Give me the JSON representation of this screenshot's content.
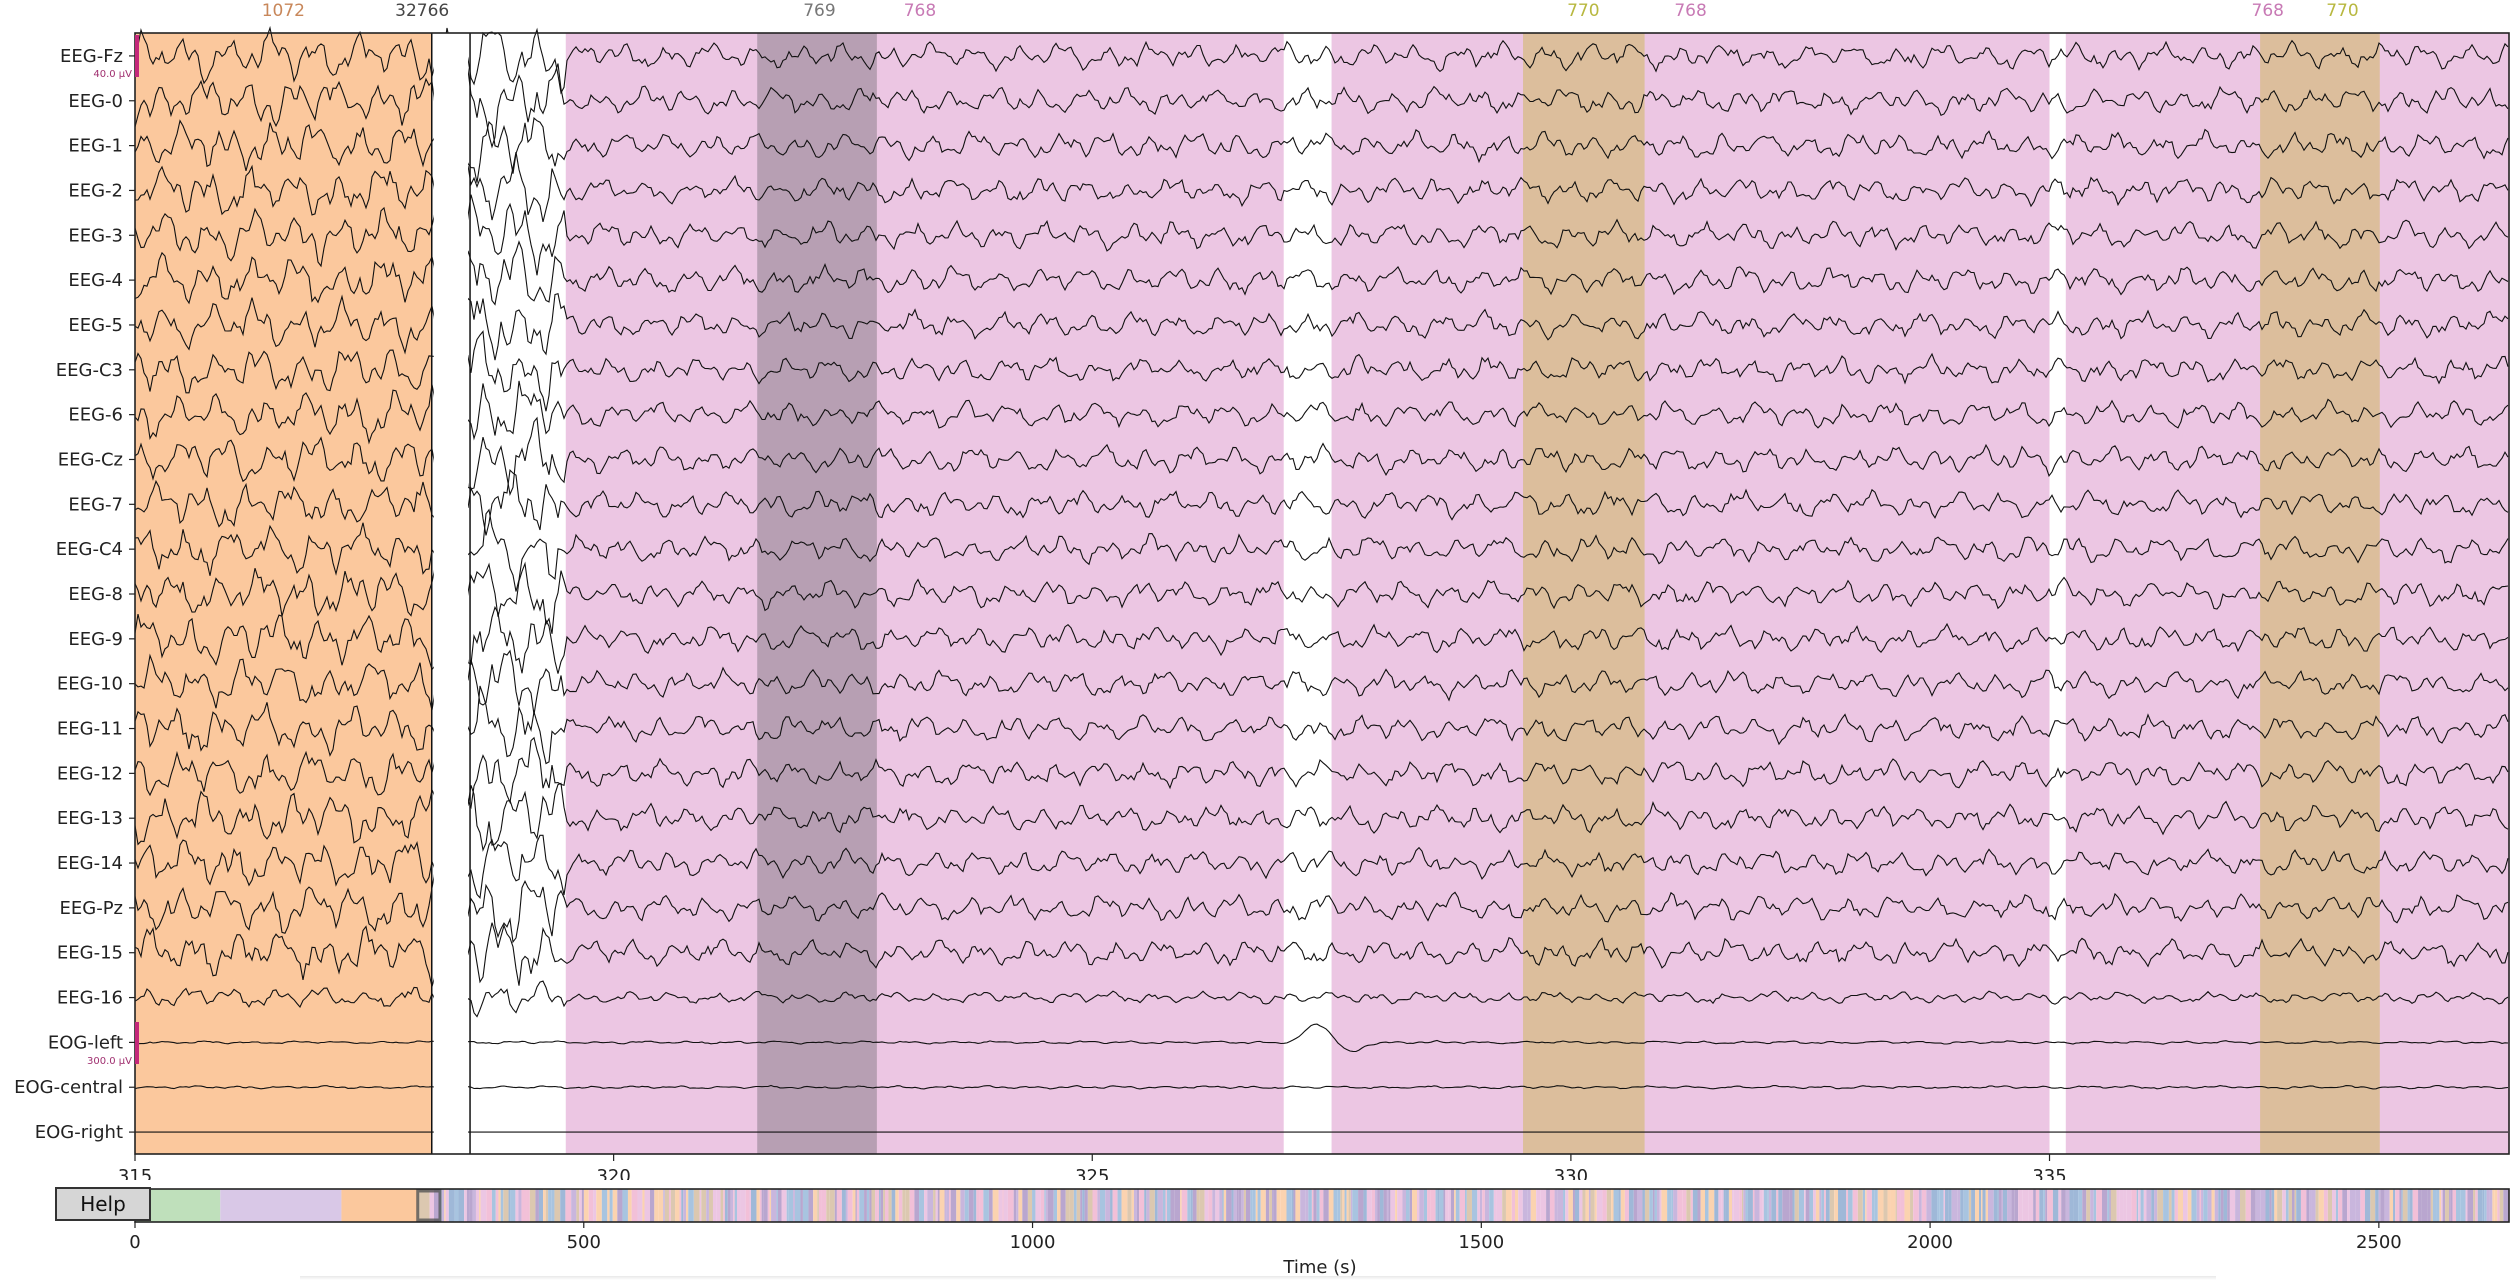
{
  "plot": {
    "x_range": [
      315,
      339.8
    ],
    "x_ticks": [
      "315",
      "320",
      "325",
      "330",
      "335"
    ],
    "x_tick_values": [
      315,
      320,
      325,
      330,
      335
    ],
    "channels": [
      "EEG-Fz",
      "EEG-0",
      "EEG-1",
      "EEG-2",
      "EEG-3",
      "EEG-4",
      "EEG-5",
      "EEG-C3",
      "EEG-6",
      "EEG-Cz",
      "EEG-7",
      "EEG-C4",
      "EEG-8",
      "EEG-9",
      "EEG-10",
      "EEG-11",
      "EEG-12",
      "EEG-13",
      "EEG-14",
      "EEG-Pz",
      "EEG-15",
      "EEG-16",
      "EOG-left",
      "EOG-central",
      "EOG-right"
    ],
    "eeg_scale_label": "40.0 µV",
    "eog_scale_label": "300.0 µV",
    "annotations": [
      {
        "label": "1072",
        "start": 315.0,
        "end": 318.1,
        "color": "#fbc89d",
        "label_color": "#c8875a",
        "label_pos": 316.55
      },
      {
        "label": "32766",
        "start": 318.1,
        "end": 318.5,
        "color": "#ffffff",
        "label_color": "#444444",
        "label_pos": 318.0
      },
      {
        "label": "768",
        "start": 319.5,
        "end": 327.0,
        "color": "#ecc6e3",
        "label_color": "#c87ab5",
        "label_pos": 323.2
      },
      {
        "label": "769",
        "start": 321.5,
        "end": 322.75,
        "color": "#b79fb3",
        "label_color": "#777777",
        "label_pos": 322.15
      },
      {
        "label": "768",
        "start": 327.5,
        "end": 335.0,
        "color": "#ecc6e3",
        "label_color": "#c87ab5",
        "label_pos": 331.25
      },
      {
        "label": "770",
        "start": 329.5,
        "end": 330.77,
        "color": "#dcbe9c",
        "label_color": "#b8b840",
        "label_pos": 330.13
      },
      {
        "label": "768",
        "start": 335.17,
        "end": 339.8,
        "color": "#ecc6e3",
        "label_color": "#c87ab5",
        "label_pos": 337.28
      },
      {
        "label": "770",
        "start": 337.2,
        "end": 338.45,
        "color": "#dcbe9c",
        "label_color": "#b8b840",
        "label_pos": 338.06
      }
    ]
  },
  "overview": {
    "x_ticks": [
      "0",
      "500",
      "1000",
      "1500",
      "2000",
      "2500"
    ],
    "x_tick_values": [
      0,
      500,
      1000,
      1500,
      2000,
      2500
    ],
    "x_max": 2645,
    "view_start": 315,
    "view_end": 339.8,
    "blocks": [
      {
        "start": 0,
        "end": 95,
        "color": "#bfe0bb"
      },
      {
        "start": 95,
        "end": 230,
        "color": "#d9c8e7"
      },
      {
        "start": 230,
        "end": 315,
        "color": "#fbc89d"
      }
    ]
  },
  "help_label": "Help",
  "xlabel": "Time (s)"
}
